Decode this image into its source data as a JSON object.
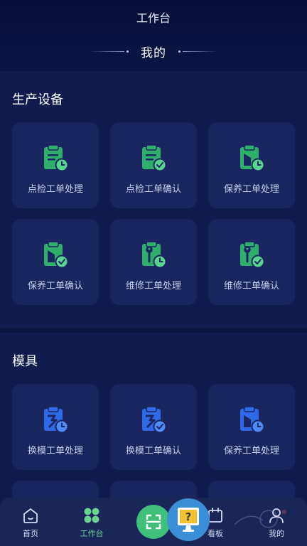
{
  "app": {
    "title": "工作台"
  },
  "heading": "我的",
  "colors": {
    "accent_green": "#3fbf7a",
    "accent_blue": "#2f6ae6",
    "help_blue": "#3a8fd6"
  },
  "sections": [
    {
      "title": "生产设备",
      "items": [
        {
          "label": "点检工单处理",
          "icon": "clipboard-clock-icon"
        },
        {
          "label": "点检工单确认",
          "icon": "clipboard-check-icon"
        },
        {
          "label": "保养工单处理",
          "icon": "clipboard-oil-clock-icon"
        },
        {
          "label": "保养工单确认",
          "icon": "clipboard-oil-check-icon"
        },
        {
          "label": "维修工单处理",
          "icon": "clipboard-wrench-clock-icon"
        },
        {
          "label": "维修工单确认",
          "icon": "clipboard-wrench-check-icon"
        }
      ]
    },
    {
      "title": "模具",
      "items": [
        {
          "label": "换模工单处理",
          "icon": "clipboard-swap-clock-icon"
        },
        {
          "label": "换模工单确认",
          "icon": "clipboard-swap-check-icon"
        },
        {
          "label": "保养工单处理",
          "icon": "clipboard-oil-clock-icon"
        }
      ]
    }
  ],
  "tabbar": {
    "home": "首页",
    "workbench": "工作台",
    "board": "看板",
    "mine": "我的"
  }
}
